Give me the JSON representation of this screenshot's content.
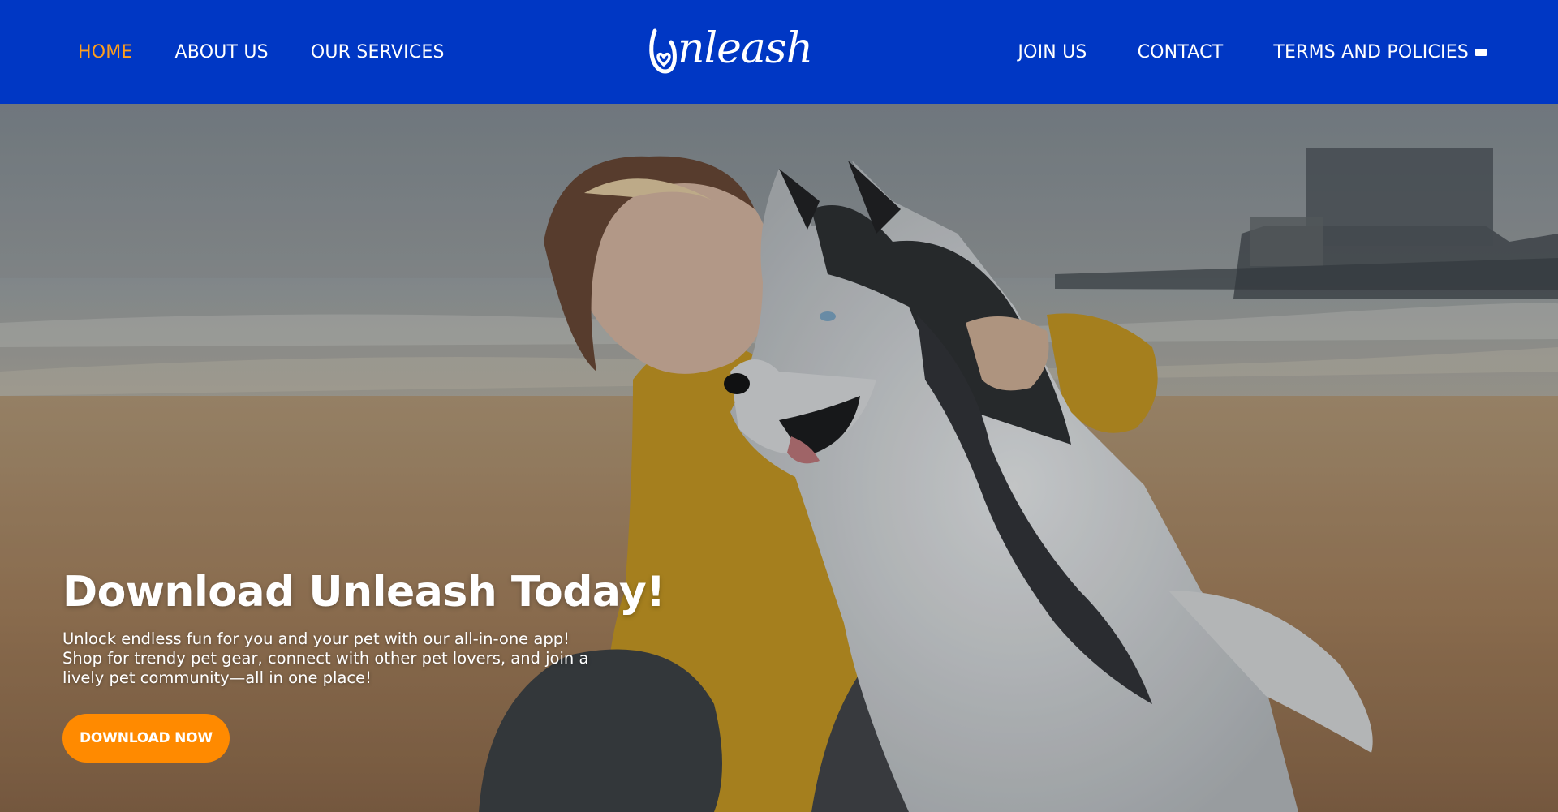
{
  "nav": {
    "left": [
      {
        "label": "HOME",
        "active": true
      },
      {
        "label": "ABOUT US",
        "active": false
      },
      {
        "label": "OUR SERVICES",
        "active": false
      }
    ],
    "right": [
      {
        "label": "JOIN US"
      },
      {
        "label": "CONTACT"
      },
      {
        "label": "TERMS AND POLICIES"
      }
    ],
    "logo_text": "nleash"
  },
  "hero": {
    "title": "Download Unleash Today!",
    "description": "Unlock endless fun for you and your pet with our all-in-one app! Shop for trendy pet gear, connect with other pet lovers, and join a lively pet community—all in one place!",
    "cta_label": "DOWNLOAD NOW"
  },
  "colors": {
    "navbar": "#0037c4",
    "active_nav": "#ff9e1b",
    "cta": "#ff8a00"
  },
  "icons": {
    "logo": "heart-u-logo-icon",
    "flag": "flag-icon"
  }
}
